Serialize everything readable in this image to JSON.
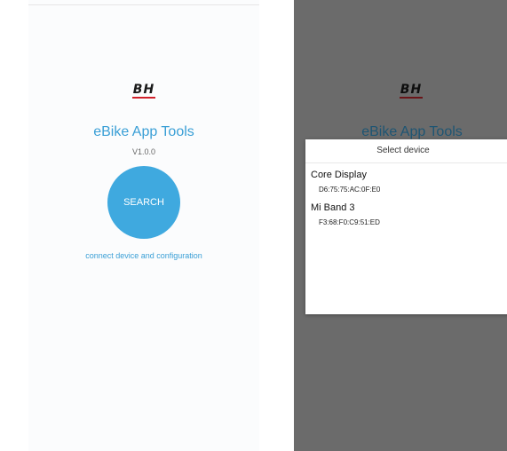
{
  "left_screen": {
    "brand_logo": "BH",
    "app_title": "eBike App Tools",
    "version": "V1.0.0",
    "search_button": "SEARCH",
    "connect_link": "connect device and configuration"
  },
  "right_screen": {
    "brand_logo": "BH",
    "app_title": "eBike App Tools",
    "dialog": {
      "title": "Select device",
      "devices": [
        {
          "name": "Core Display",
          "mac": "D6:75:75:AC:0F:E0"
        },
        {
          "name": "Mi Band 3",
          "mac": "F3:68:F0:C9:51:ED"
        }
      ]
    }
  },
  "colors": {
    "accent": "#3fa9df",
    "overlay": "#6b6b6b",
    "logo_underline": "#d0202a"
  }
}
